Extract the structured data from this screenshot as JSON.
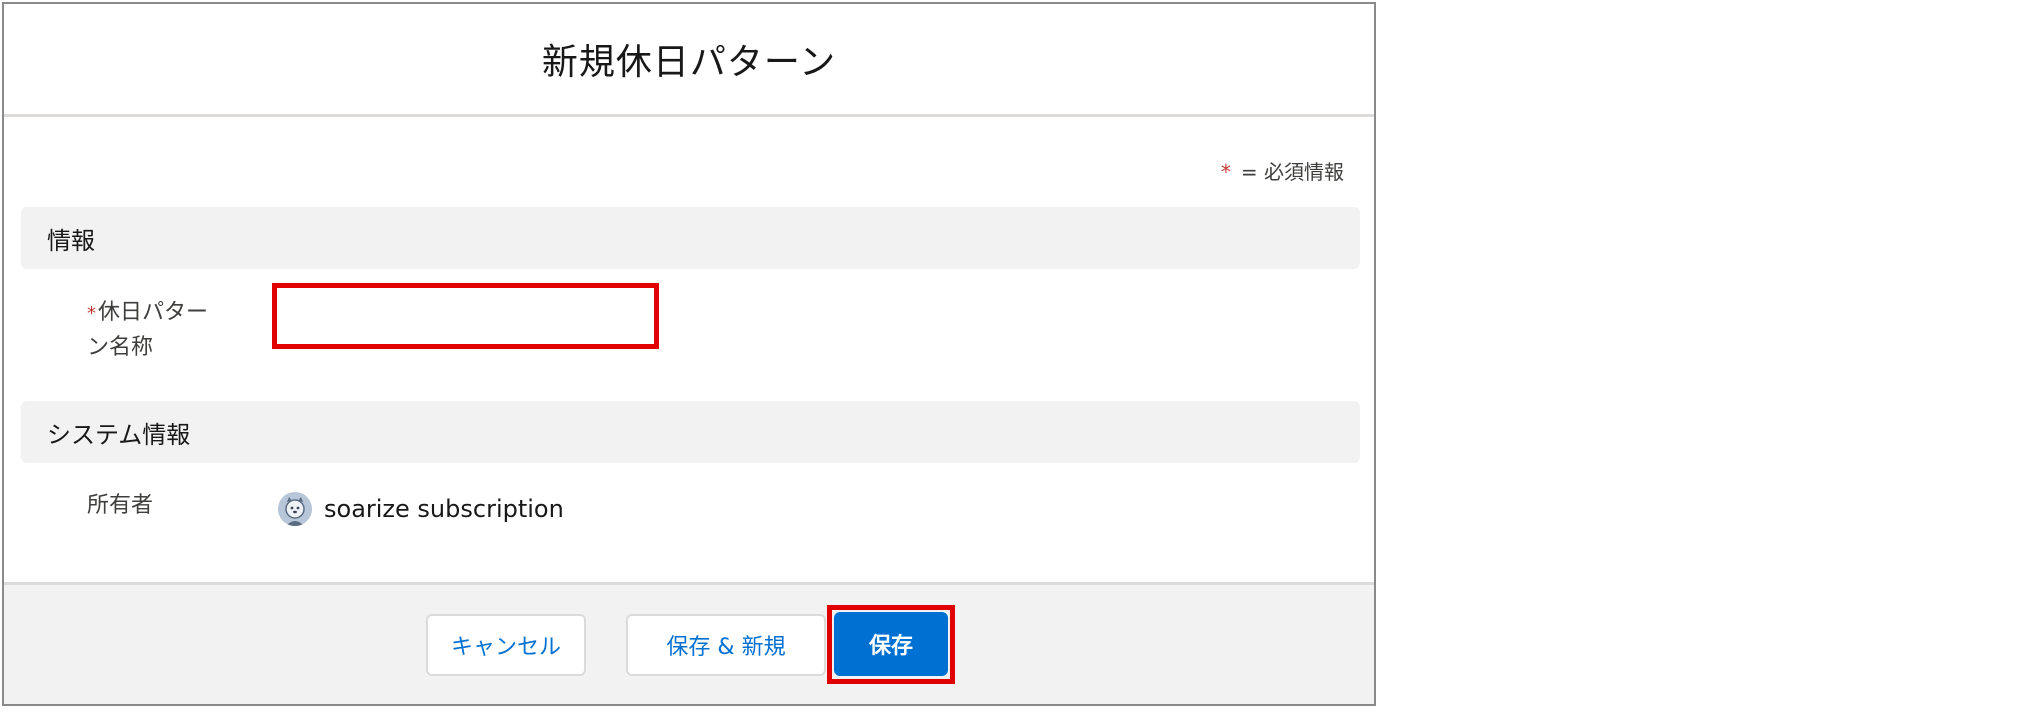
{
  "dialog": {
    "title": "新規休日パターン"
  },
  "required_legend": {
    "star": "*",
    "text": "= 必須情報"
  },
  "sections": {
    "info": {
      "title": "情報"
    },
    "system": {
      "title": "システム情報"
    }
  },
  "fields": {
    "holiday_pattern_name": {
      "required_mark": "*",
      "label_line1": "休日パター",
      "label_line2": "ン名称",
      "value": ""
    },
    "owner": {
      "label": "所有者",
      "value": "soarize subscription",
      "icon": "user-avatar-icon"
    }
  },
  "footer": {
    "cancel_label": "キャンセル",
    "save_new_label": "保存 & 新規",
    "save_label": "保存"
  },
  "colors": {
    "primary": "#0070d2",
    "required": "#c23934",
    "highlight": "#e00000",
    "section_bg": "#f3f2f2"
  }
}
